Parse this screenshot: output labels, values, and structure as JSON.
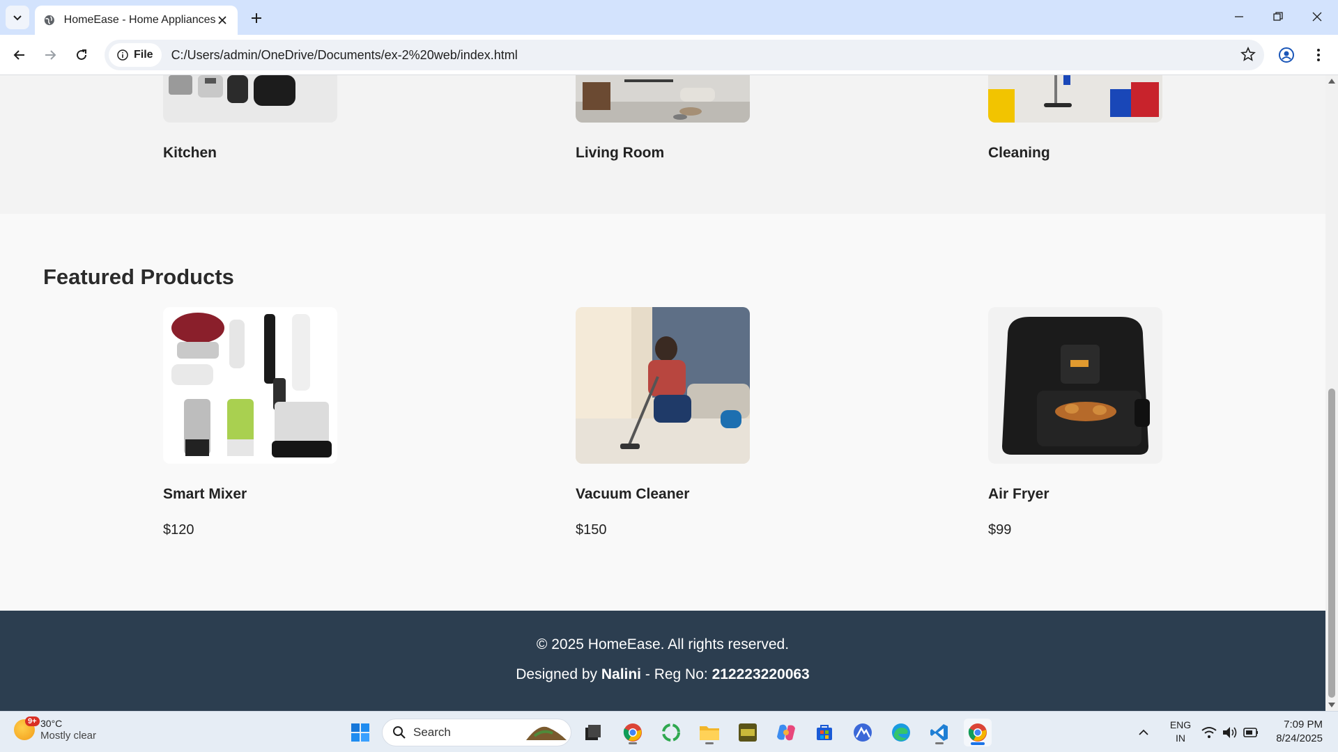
{
  "browser": {
    "tab_title": "HomeEase - Home Appliances",
    "site_chip": "File",
    "url": "C:/Users/admin/OneDrive/Documents/ex-2%20web/index.html"
  },
  "categories": [
    {
      "name": "Kitchen"
    },
    {
      "name": "Living Room"
    },
    {
      "name": "Cleaning"
    }
  ],
  "featured": {
    "title": "Featured Products",
    "products": [
      {
        "name": "Smart Mixer",
        "price": "$120"
      },
      {
        "name": "Vacuum Cleaner",
        "price": "$150"
      },
      {
        "name": "Air Fryer",
        "price": "$99"
      }
    ]
  },
  "footer": {
    "copyright": "© 2025 HomeEase. All rights reserved.",
    "designed_by_label": "Designed by ",
    "designer": "Nalini",
    "reg_label": " - Reg No: ",
    "reg_no": "212223220063"
  },
  "taskbar": {
    "weather_badge": "9+",
    "temperature": "30°C",
    "condition": "Mostly clear",
    "search_label": "Search",
    "lang_top": "ENG",
    "lang_bottom": "IN",
    "time": "7:09 PM",
    "date": "8/24/2025"
  },
  "colors": {
    "footer_bg": "#2c3e50",
    "tabbar_bg": "#d3e3fd",
    "page_bg": "#f9f9f9"
  }
}
